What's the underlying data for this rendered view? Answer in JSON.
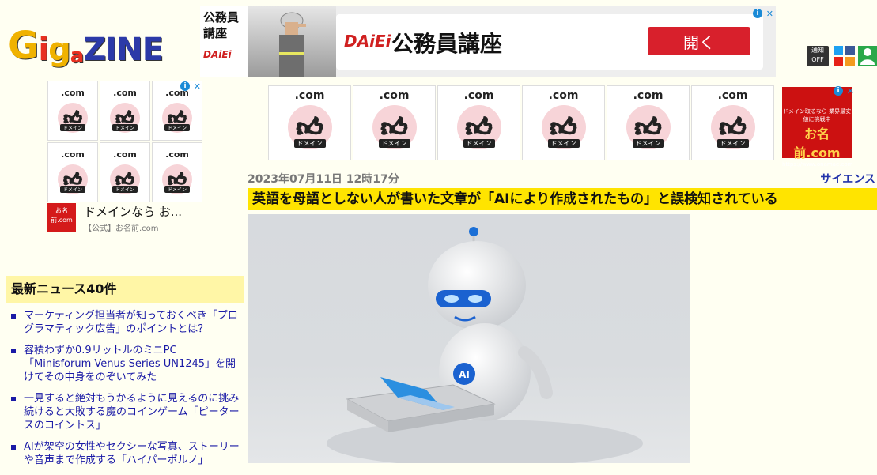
{
  "site": {
    "logo": [
      "G",
      "i",
      "g",
      "a",
      "Z",
      "I",
      "N",
      "E"
    ]
  },
  "top_ad": {
    "left_text": "公務員\n講座",
    "daiei_mini": "DAiEi",
    "brand": "DAiEi",
    "headline": "公務員講座",
    "button": "開く"
  },
  "header_icons": {
    "notify_label": "通知",
    "notify_state": "OFF"
  },
  "domain_ad": {
    "tile_label": ".com",
    "tag_label": "ドメイン",
    "left_tile_count": 6,
    "top_tile_count": 6,
    "text_title": "ドメインなら お...",
    "text_source": "【公式】お名前.com",
    "onamae_small": "ドメイン取るなら 業界最安値に挑戦中",
    "onamae_big": "お名前.com",
    "onamae_url": "https://www.onamae.com"
  },
  "sidebar": {
    "news_heading": "最新ニュース40件",
    "news": [
      "マーケティング担当者が知っておくべき「プログラマティック広告」のポイントとは？",
      "容積わずか0.9リットルのミニPC「Minisforum Venus Series UN1245」を開けてその中身をのぞいてみた",
      "一見すると絶対もうかるように見えるのに挑み続けると大敗する魔のコインゲーム「ピータースのコイントス」",
      "AIが架空の女性やセクシーな写真、ストーリーや音声まで作成する「ハイパーポルノ」"
    ]
  },
  "article": {
    "date": "2023年07月11日 12時17分",
    "category": "サイエンス",
    "title": "英語を母語としない人が書いた文章が「AIにより作成されたもの」と誤検知されている",
    "image_badge": "AI"
  },
  "colors": {
    "title_bg": "#ffe400",
    "news_heading_bg": "#fff6a6",
    "link": "#1a1aa6",
    "ad_button": "#d8202c"
  }
}
